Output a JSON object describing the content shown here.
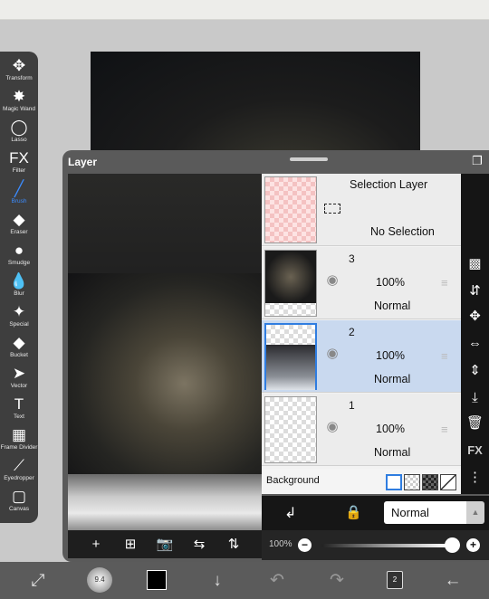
{
  "toolbar": {
    "tools": [
      {
        "label": "Transform",
        "icon": "✥"
      },
      {
        "label": "Magic Wand",
        "icon": "✸"
      },
      {
        "label": "Lasso",
        "icon": "◯"
      },
      {
        "label": "Filter",
        "icon": "FX"
      },
      {
        "label": "Brush",
        "icon": "╱",
        "active": true
      },
      {
        "label": "Eraser",
        "icon": "◆"
      },
      {
        "label": "Smudge",
        "icon": "●"
      },
      {
        "label": "Blur",
        "icon": "💧"
      },
      {
        "label": "Special",
        "icon": "✦"
      },
      {
        "label": "Bucket",
        "icon": "◆"
      },
      {
        "label": "Vector",
        "icon": "➤"
      },
      {
        "label": "Text",
        "icon": "T"
      },
      {
        "label": "Frame Divider",
        "icon": "▦"
      },
      {
        "label": "Eyedropper",
        "icon": "⟋"
      },
      {
        "label": "Canvas",
        "icon": "▢"
      }
    ]
  },
  "panel": {
    "title": "Layer",
    "preview_tools": [
      "+",
      "⊞",
      "📷",
      "⇆",
      "⇅"
    ],
    "selection_layer": {
      "title": "Selection Layer",
      "subtitle": "No Selection"
    },
    "layers": [
      {
        "number": "3",
        "opacity": "100%",
        "blend": "Normal"
      },
      {
        "number": "2",
        "opacity": "100%",
        "blend": "Normal",
        "selected": true
      },
      {
        "number": "1",
        "opacity": "100%",
        "blend": "Normal"
      }
    ],
    "background_label": "Background",
    "blend_mode": "Normal",
    "opacity_label": "100%",
    "opacity_value": 1.0,
    "right_tools": [
      "▩",
      "⇵",
      "✥",
      "⇔",
      "⇕",
      "⤓",
      "🗑",
      "FX",
      "⋮"
    ]
  },
  "bottom_bar": {
    "brush_size": "9.4",
    "page_count": "2",
    "icons": [
      "transform-icon",
      "brush-size-icon",
      "color-swatch",
      "down-arrow-icon",
      "undo-icon",
      "redo-icon",
      "layers-icon",
      "back-arrow-icon"
    ]
  },
  "colors": {
    "accent": "#3b8cff",
    "selected_row": "#c9d9ef",
    "toolbar_bg": "#3e3e3e"
  }
}
